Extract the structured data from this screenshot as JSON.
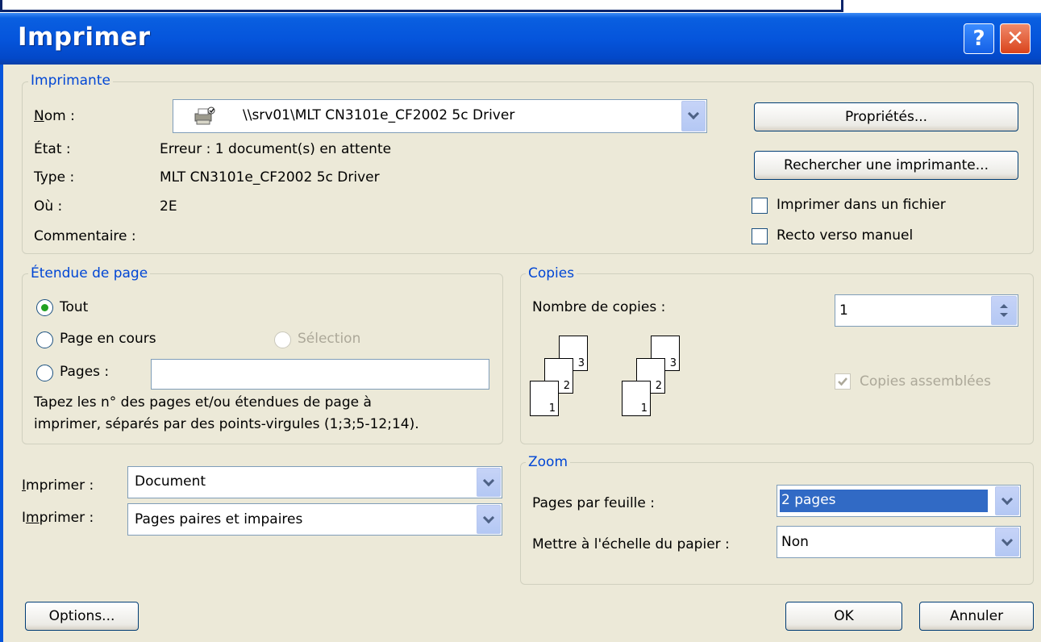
{
  "window": {
    "title": "Imprimer"
  },
  "printer_group": {
    "legend": "Imprimante",
    "name_label": "Nom :",
    "name_value": "\\\\srv01\\MLT CN3101e_CF2002 5c Driver",
    "state_label": "État :",
    "state_value": "Erreur : 1 document(s) en attente",
    "type_label": "Type :",
    "type_value": "MLT CN3101e_CF2002 5c Driver",
    "where_label": "Où :",
    "where_value": "2E",
    "comment_label": "Commentaire :",
    "properties_button": "Propriétés...",
    "find_printer_button": "Rechercher une imprimante...",
    "print_to_file_label": "Imprimer dans un fichier",
    "manual_duplex_label": "Recto verso manuel",
    "print_to_file_checked": false,
    "manual_duplex_checked": false
  },
  "page_range_group": {
    "legend": "Étendue de page",
    "all_label": "Tout",
    "current_page_label": "Page en cours",
    "selection_label": "Sélection",
    "pages_label": "Pages :",
    "pages_value": "",
    "hint_line1": "Tapez les n° des pages et/ou étendues de page à",
    "hint_line2": "imprimer, séparés par des points-virgules (1;3;5-12;14).",
    "selected": "all"
  },
  "copies_group": {
    "legend": "Copies",
    "count_label": "Nombre de copies :",
    "count_value": "1",
    "collate_label": "Copies assemblées",
    "collate_checked": true,
    "collate_enabled": false,
    "page_numbers": [
      "3",
      "2",
      "1"
    ]
  },
  "print_what": {
    "label": "Imprimer :",
    "value": "Document"
  },
  "print_pages": {
    "label": "Imprimer :",
    "value": "Pages paires et impaires"
  },
  "zoom_group": {
    "legend": "Zoom",
    "pages_per_sheet_label": "Pages par feuille :",
    "pages_per_sheet_value": "2 pages",
    "scale_label": "Mettre à l'échelle du papier :",
    "scale_value": "Non"
  },
  "footer": {
    "options_button": "Options...",
    "ok_button": "OK",
    "cancel_button": "Annuler"
  },
  "colors": {
    "title_bar": "#0555dc",
    "legend": "#0046d5",
    "dialog_bg": "#ece9d8",
    "selection": "#316ac5"
  }
}
